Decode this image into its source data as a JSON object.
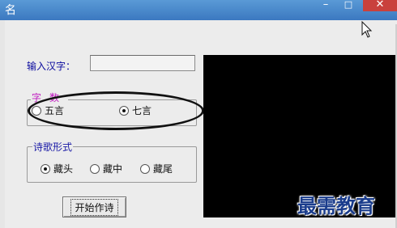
{
  "window": {
    "title": "名",
    "controls": {
      "minimize": "–",
      "maximize": "□",
      "close": "✕"
    }
  },
  "form": {
    "input_label": "输入汉字：",
    "input_value": ""
  },
  "group_char_count": {
    "title": "字数",
    "options": [
      {
        "label": "五言",
        "selected": false
      },
      {
        "label": "七言",
        "selected": true
      }
    ]
  },
  "group_poem_style": {
    "title": "诗歌形式",
    "options": [
      {
        "label": "藏头",
        "selected": true
      },
      {
        "label": "藏中",
        "selected": false
      },
      {
        "label": "藏尾",
        "selected": false
      }
    ]
  },
  "actions": {
    "start_label": "开始作诗"
  },
  "watermark": "最需教育",
  "colors": {
    "titlebar": "#3b78c0",
    "close_button": "#c9413d",
    "label_blue": "#0a0a9e",
    "group_title_magenta": "#c020c0",
    "display_bg": "#000000",
    "watermark": "#1a3c8c"
  }
}
